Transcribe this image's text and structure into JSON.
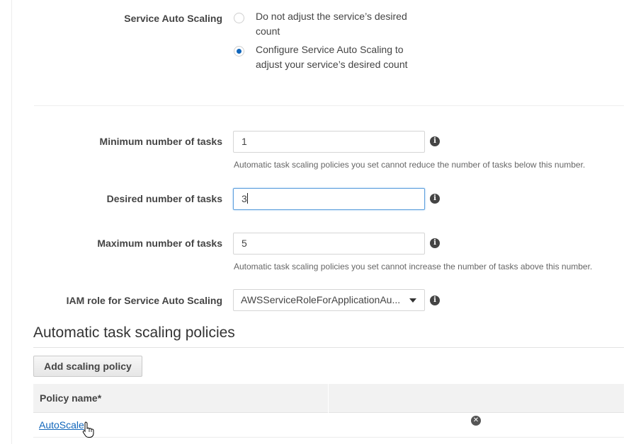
{
  "auto_scaling": {
    "label": "Service Auto Scaling",
    "options": [
      {
        "label": "Do not adjust the service’s desired count",
        "checked": false
      },
      {
        "label": "Configure Service Auto Scaling to adjust your service’s desired count",
        "checked": true
      }
    ]
  },
  "min_tasks": {
    "label": "Minimum number of tasks",
    "value": "1",
    "hint": "Automatic task scaling policies you set cannot reduce the number of tasks below this number."
  },
  "desired_tasks": {
    "label": "Desired number of tasks",
    "value": "3"
  },
  "max_tasks": {
    "label": "Maximum number of tasks",
    "value": "5",
    "hint": "Automatic task scaling policies you set cannot increase the number of tasks above this number."
  },
  "iam_role": {
    "label": "IAM role for Service Auto Scaling",
    "value": "AWSServiceRoleForApplicationAu..."
  },
  "policies": {
    "title": "Automatic task scaling policies",
    "add_button": "Add scaling policy",
    "column_header": "Policy name*",
    "rows": [
      {
        "name": "AutoScale"
      }
    ]
  },
  "icons": {
    "info": "info-icon",
    "remove": "close-circle-icon",
    "cursor": "hand-pointer-icon"
  },
  "colors": {
    "accent": "#1166bb",
    "focus_border": "#5fa0dd"
  }
}
